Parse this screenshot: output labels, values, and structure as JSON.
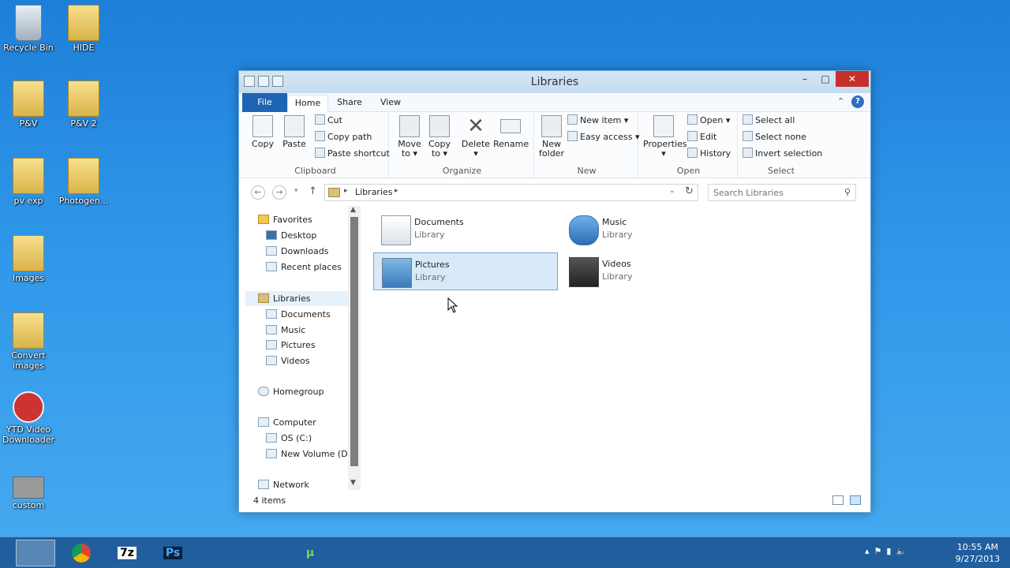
{
  "desktop": {
    "icons": [
      {
        "label": "Recycle Bin",
        "icon": "recycle-bin-icon"
      },
      {
        "label": "HIDE",
        "icon": "folder-icon"
      },
      {
        "label": "P&V",
        "icon": "folder-icon"
      },
      {
        "label": "P&V 2",
        "icon": "folder-icon"
      },
      {
        "label": "pv exp",
        "icon": "folder-icon"
      },
      {
        "label": "Photogen...",
        "icon": "lock-folder-icon"
      },
      {
        "label": "Images",
        "icon": "folder-icon"
      },
      {
        "label": "Convert images",
        "icon": "folder-icon"
      },
      {
        "label": "YTD Video Downloader",
        "icon": "ytd-icon"
      },
      {
        "label": "custom",
        "icon": "image-file-icon"
      }
    ]
  },
  "window": {
    "title": "Libraries",
    "minimize": "–",
    "maximize": "□",
    "close": "✕"
  },
  "ribbon": {
    "tabs": {
      "file": "File",
      "home": "Home",
      "share": "Share",
      "view": "View"
    },
    "clipboard": {
      "label": "Clipboard",
      "copy": "Copy",
      "paste": "Paste",
      "cut": "Cut",
      "copy_path": "Copy path",
      "paste_shortcut": "Paste shortcut"
    },
    "organize": {
      "label": "Organize",
      "move_to_1": "Move",
      "move_to_2": "to ▾",
      "copy_to_1": "Copy",
      "copy_to_2": "to ▾",
      "delete_1": "Delete",
      "delete_2": "▾",
      "rename": "Rename"
    },
    "new": {
      "label": "New",
      "new_folder_1": "New",
      "new_folder_2": "folder",
      "new_item": "New item ▾",
      "easy_access": "Easy access ▾"
    },
    "open": {
      "label": "Open",
      "properties_1": "Properties",
      "properties_2": "▾",
      "open": "Open ▾",
      "edit": "Edit",
      "history": "History"
    },
    "select": {
      "label": "Select",
      "select_all": "Select all",
      "select_none": "Select none",
      "invert_selection": "Invert selection"
    }
  },
  "address": {
    "crumb": "Libraries",
    "search_placeholder": "Search Libraries"
  },
  "nav": {
    "favorites": "Favorites",
    "desktop": "Desktop",
    "downloads": "Downloads",
    "recent_places": "Recent places",
    "libraries": "Libraries",
    "documents": "Documents",
    "music": "Music",
    "pictures": "Pictures",
    "videos": "Videos",
    "homegroup": "Homegroup",
    "computer": "Computer",
    "os_c": "OS (C:)",
    "new_volume": "New Volume (D:)",
    "network": "Network"
  },
  "content": {
    "items": [
      {
        "name": "Documents",
        "type": "Library"
      },
      {
        "name": "Music",
        "type": "Library"
      },
      {
        "name": "Pictures",
        "type": "Library"
      },
      {
        "name": "Videos",
        "type": "Library"
      }
    ]
  },
  "status": {
    "count": "4 items"
  },
  "taskbar": {
    "apps": [
      {
        "icon": "file-explorer-icon",
        "glyph": ""
      },
      {
        "icon": "chrome-icon",
        "glyph": ""
      },
      {
        "icon": "7zip-icon",
        "glyph": "7z"
      },
      {
        "icon": "photoshop-icon",
        "glyph": "Ps"
      },
      {
        "icon": "app-icon",
        "glyph": ""
      },
      {
        "icon": "paint-icon",
        "glyph": ""
      },
      {
        "icon": "utorrent-icon",
        "glyph": "µ"
      },
      {
        "icon": "app-icon",
        "glyph": ""
      },
      {
        "icon": "app-icon",
        "glyph": ""
      },
      {
        "icon": "app-icon",
        "glyph": ""
      }
    ],
    "time": "10:55 AM",
    "date": "9/27/2013"
  },
  "colors": {
    "accent": "#1e64b4",
    "selection": "#d8eaf9",
    "close": "#c7302a"
  }
}
